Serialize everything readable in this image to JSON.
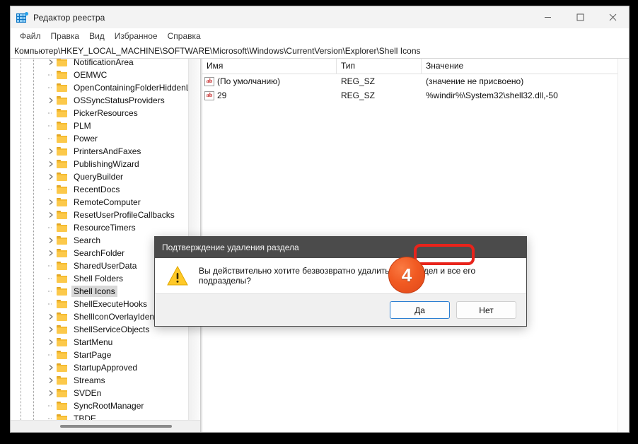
{
  "window": {
    "title": "Редактор реестра",
    "icon": "registry-editor-icon",
    "controls": {
      "minimize": "—",
      "maximize": "▢",
      "close": "✕"
    }
  },
  "menu": {
    "items": [
      "Файл",
      "Правка",
      "Вид",
      "Избранное",
      "Справка"
    ]
  },
  "address": {
    "path": "Компьютер\\HKEY_LOCAL_MACHINE\\SOFTWARE\\Microsoft\\Windows\\CurrentVersion\\Explorer\\Shell Icons"
  },
  "tree": {
    "items": [
      {
        "label": "NotificationArea",
        "expandable": true,
        "selected": false
      },
      {
        "label": "OEMWC",
        "expandable": false,
        "selected": false
      },
      {
        "label": "OpenContainingFolderHiddenList",
        "expandable": false,
        "selected": false
      },
      {
        "label": "OSSyncStatusProviders",
        "expandable": true,
        "selected": false
      },
      {
        "label": "PickerResources",
        "expandable": false,
        "selected": false
      },
      {
        "label": "PLM",
        "expandable": false,
        "selected": false
      },
      {
        "label": "Power",
        "expandable": false,
        "selected": false
      },
      {
        "label": "PrintersAndFaxes",
        "expandable": true,
        "selected": false
      },
      {
        "label": "PublishingWizard",
        "expandable": true,
        "selected": false
      },
      {
        "label": "QueryBuilder",
        "expandable": true,
        "selected": false
      },
      {
        "label": "RecentDocs",
        "expandable": false,
        "selected": false
      },
      {
        "label": "RemoteComputer",
        "expandable": true,
        "selected": false
      },
      {
        "label": "ResetUserProfileCallbacks",
        "expandable": true,
        "selected": false
      },
      {
        "label": "ResourceTimers",
        "expandable": false,
        "selected": false
      },
      {
        "label": "Search",
        "expandable": true,
        "selected": false
      },
      {
        "label": "SearchFolder",
        "expandable": true,
        "selected": false
      },
      {
        "label": "SharedUserData",
        "expandable": false,
        "selected": false
      },
      {
        "label": "Shell Folders",
        "expandable": false,
        "selected": false
      },
      {
        "label": "Shell Icons",
        "expandable": false,
        "selected": true
      },
      {
        "label": "ShellExecuteHooks",
        "expandable": false,
        "selected": false
      },
      {
        "label": "ShellIconOverlayIdentifiers",
        "expandable": true,
        "selected": false
      },
      {
        "label": "ShellServiceObjects",
        "expandable": true,
        "selected": false
      },
      {
        "label": "StartMenu",
        "expandable": true,
        "selected": false
      },
      {
        "label": "StartPage",
        "expandable": false,
        "selected": false
      },
      {
        "label": "StartupApproved",
        "expandable": true,
        "selected": false
      },
      {
        "label": "Streams",
        "expandable": true,
        "selected": false
      },
      {
        "label": "SVDEn",
        "expandable": true,
        "selected": false
      },
      {
        "label": "SyncRootManager",
        "expandable": false,
        "selected": false
      },
      {
        "label": "TBDE",
        "expandable": false,
        "selected": false
      }
    ]
  },
  "values": {
    "columns": [
      "Имя",
      "Тип",
      "Значение"
    ],
    "rows": [
      {
        "name": "(По умолчанию)",
        "type": "REG_SZ",
        "value": "(значение не присвоено)"
      },
      {
        "name": "29",
        "type": "REG_SZ",
        "value": "%windir%\\System32\\shell32.dll,-50"
      }
    ]
  },
  "dialog": {
    "title": "Подтверждение удаления раздела",
    "message": "Вы действительно хотите безвозвратно удалить этот раздел и все его подразделы?",
    "icon": "warning-icon",
    "buttons": {
      "confirm": "Да",
      "cancel": "Нет"
    }
  },
  "annotation": {
    "step_number": "4",
    "highlight_color": "#e8231b",
    "badge_color": "#f15a22"
  }
}
